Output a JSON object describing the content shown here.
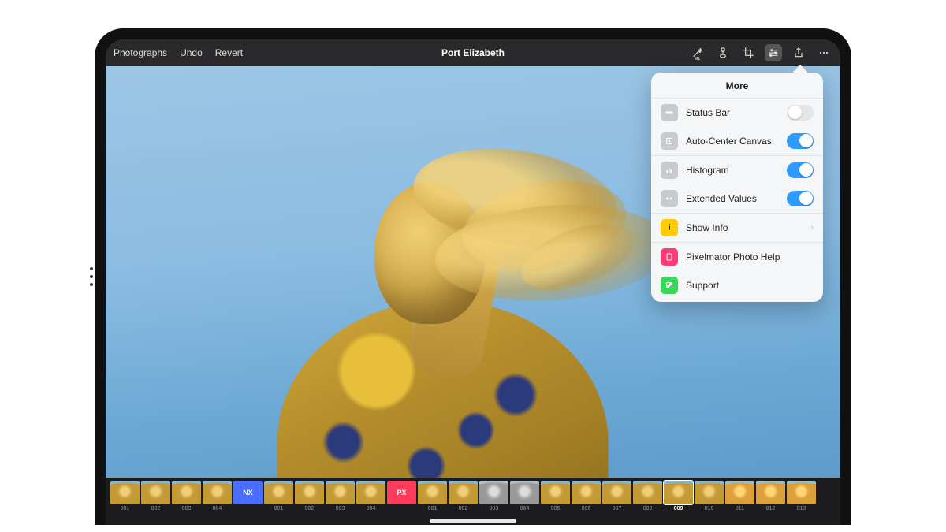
{
  "toolbar": {
    "photographs_label": "Photographs",
    "undo_label": "Undo",
    "revert_label": "Revert",
    "title": "Port Elizabeth"
  },
  "popover": {
    "title": "More",
    "status_bar": {
      "label": "Status Bar",
      "on": false
    },
    "auto_center": {
      "label": "Auto-Center Canvas",
      "on": true
    },
    "histogram": {
      "label": "Histogram",
      "on": true
    },
    "extended_values": {
      "label": "Extended Values",
      "on": true
    },
    "show_info": {
      "label": "Show Info"
    },
    "help": {
      "label": "Pixelmator Photo Help"
    },
    "support": {
      "label": "Support"
    }
  },
  "thumbs": [
    {
      "label": "001"
    },
    {
      "label": "002"
    },
    {
      "label": "003"
    },
    {
      "label": "004"
    },
    {
      "label": "NX",
      "badge": "nx"
    },
    {
      "label": "001"
    },
    {
      "label": "002"
    },
    {
      "label": "003"
    },
    {
      "label": "004"
    },
    {
      "label": "PX",
      "badge": "px"
    },
    {
      "label": "001"
    },
    {
      "label": "002"
    },
    {
      "label": "003",
      "variant": "gray"
    },
    {
      "label": "004",
      "variant": "gray"
    },
    {
      "label": "005"
    },
    {
      "label": "006"
    },
    {
      "label": "007"
    },
    {
      "label": "008"
    },
    {
      "label": "009",
      "selected": true
    },
    {
      "label": "010"
    },
    {
      "label": "011",
      "variant": "warm"
    },
    {
      "label": "012",
      "variant": "warm"
    },
    {
      "label": "013",
      "variant": "warm"
    }
  ]
}
